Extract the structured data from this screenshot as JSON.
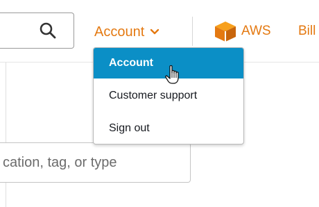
{
  "header": {
    "search_icon": "search-icon",
    "account_label": "Account",
    "account_chevron_icon": "chevron-down-icon",
    "aws_label": "AWS",
    "aws_icon": "aws-cube-icon",
    "billing_label": "Bill"
  },
  "account_menu": {
    "items": [
      {
        "label": "Account",
        "active": true
      },
      {
        "label": "Customer support",
        "active": false
      },
      {
        "label": "Sign out",
        "active": false
      }
    ]
  },
  "filter": {
    "placeholder": "cation, tag, or type"
  },
  "colors": {
    "accent_orange": "#e47911",
    "menu_highlight": "#0b8fc6"
  }
}
